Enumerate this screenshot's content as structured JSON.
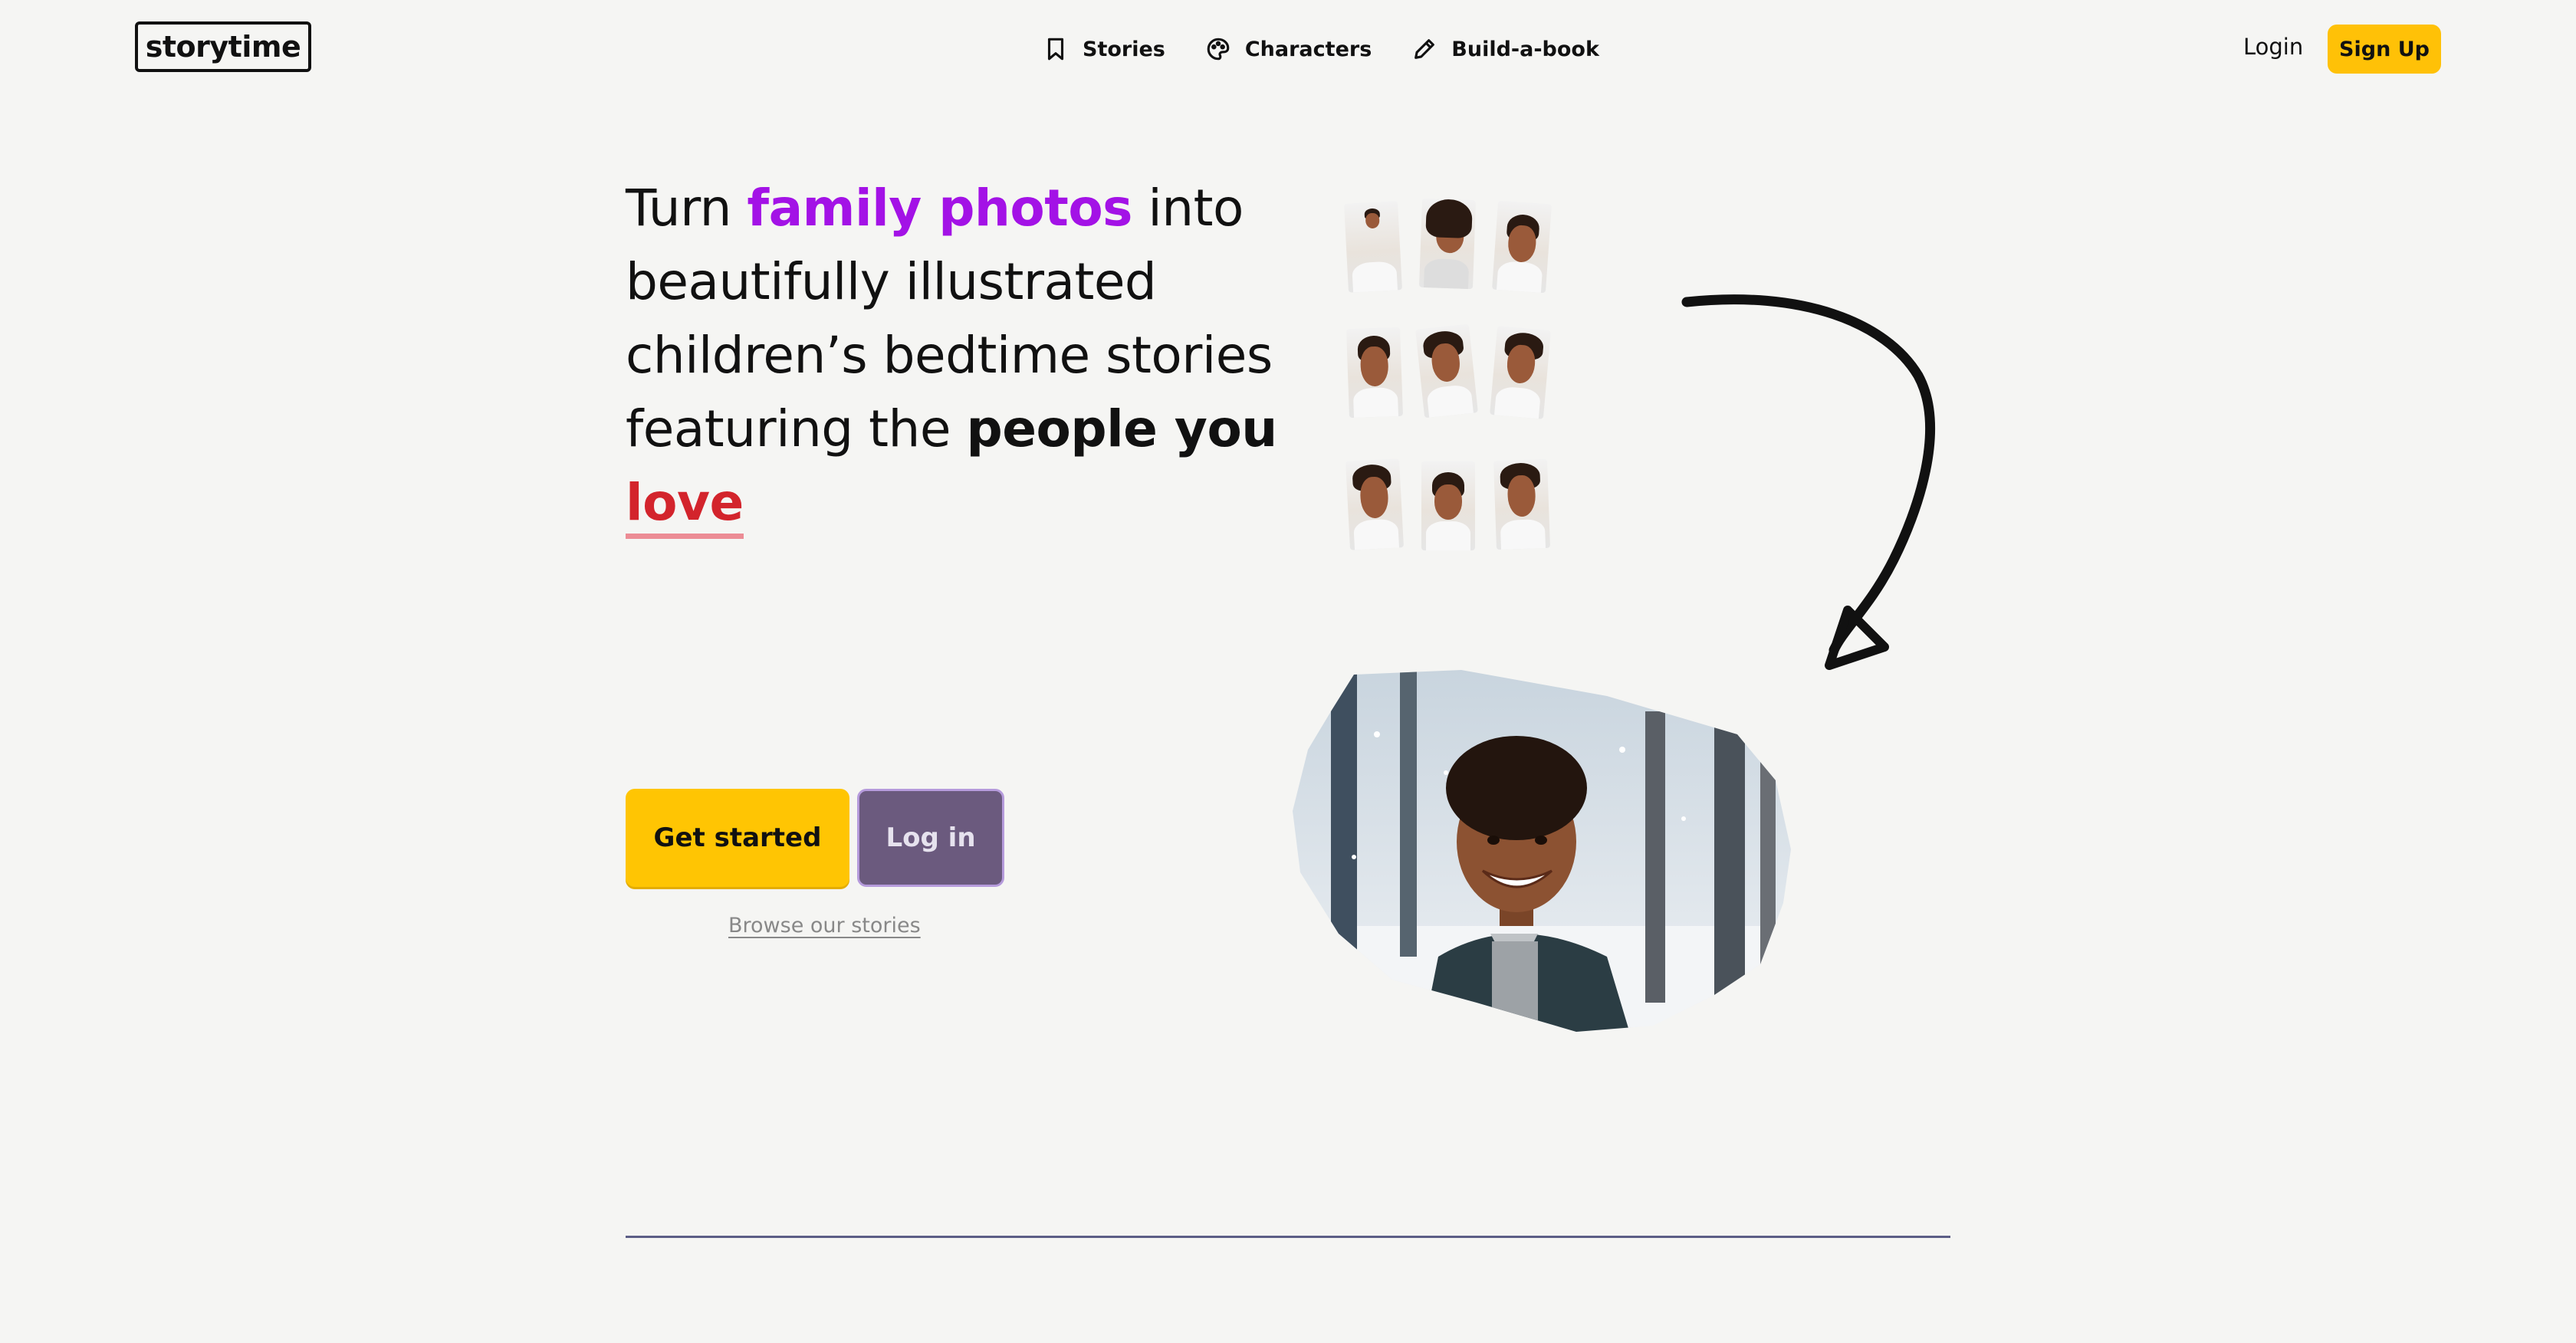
{
  "nav": {
    "logo": "storytime",
    "items": [
      {
        "label": "Stories",
        "icon": "bookmark-icon"
      },
      {
        "label": "Characters",
        "icon": "palette-icon"
      },
      {
        "label": "Build-a-book",
        "icon": "pencil-icon"
      }
    ],
    "login": "Login",
    "signup": "Sign Up"
  },
  "hero": {
    "headline": {
      "part1": "Turn ",
      "highlight": "family photos",
      "part2": " into beautifully illustrated children’s bedtime stories featuring the ",
      "bold": "people you",
      "love": "love"
    },
    "cta_primary": "Get started",
    "cta_secondary": "Log in",
    "browse_link": "Browse our stories"
  },
  "colors": {
    "accent_yellow": "#ffc503",
    "highlight_purple": "#a312e6",
    "love_red": "#d3242c",
    "login_button": "#6b5a7e",
    "divider": "#5c5e86"
  }
}
